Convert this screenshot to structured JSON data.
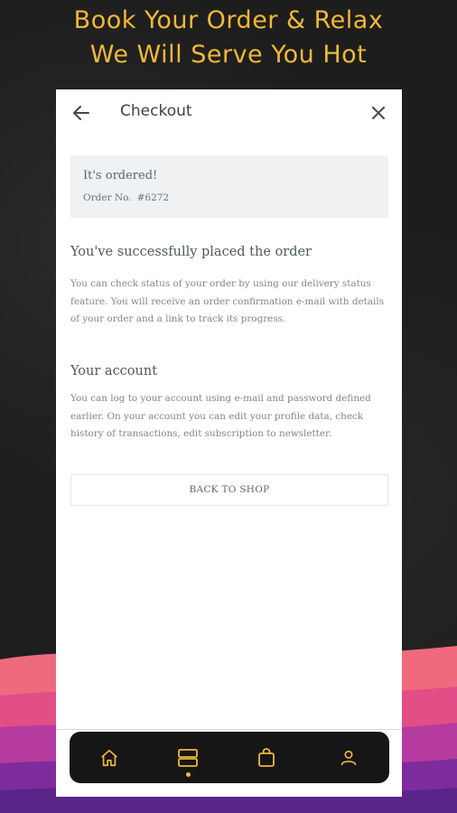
{
  "promo": {
    "line1": "Book Your Order & Relax",
    "line2": "We Will Serve You Hot"
  },
  "header": {
    "title": "Checkout",
    "back_icon": "arrow-left-icon",
    "close_icon": "close-icon"
  },
  "confirmation": {
    "title": "It's ordered!",
    "order_label": "Order No.",
    "order_number": "#6272"
  },
  "success_section": {
    "heading": "You've successfully placed the order",
    "body": "You can check status of your order by using our delivery status feature. You will receive an order confirmation e-mail with details of your order and a link to track its progress."
  },
  "account_section": {
    "heading": "Your account",
    "body": "You can log to your account using e-mail and password defined earlier. On your account you can edit your profile data, check history of transactions, edit subscription to newsletter."
  },
  "back_to_shop_label": "BACK TO SHOP",
  "bottom_nav": {
    "items": [
      {
        "icon": "home-icon",
        "active": false
      },
      {
        "icon": "orders-icon",
        "active": true
      },
      {
        "icon": "shopping-bag-icon",
        "active": false
      },
      {
        "icon": "profile-icon",
        "active": false
      }
    ]
  },
  "colors": {
    "accent": "#f0b83a",
    "nav_background": "#161616",
    "background_dark": "#1d1d1d",
    "wave_pink": "#f05a78",
    "wave_purple": "#8a2ea8",
    "wave_magenta": "#c43a9a"
  }
}
